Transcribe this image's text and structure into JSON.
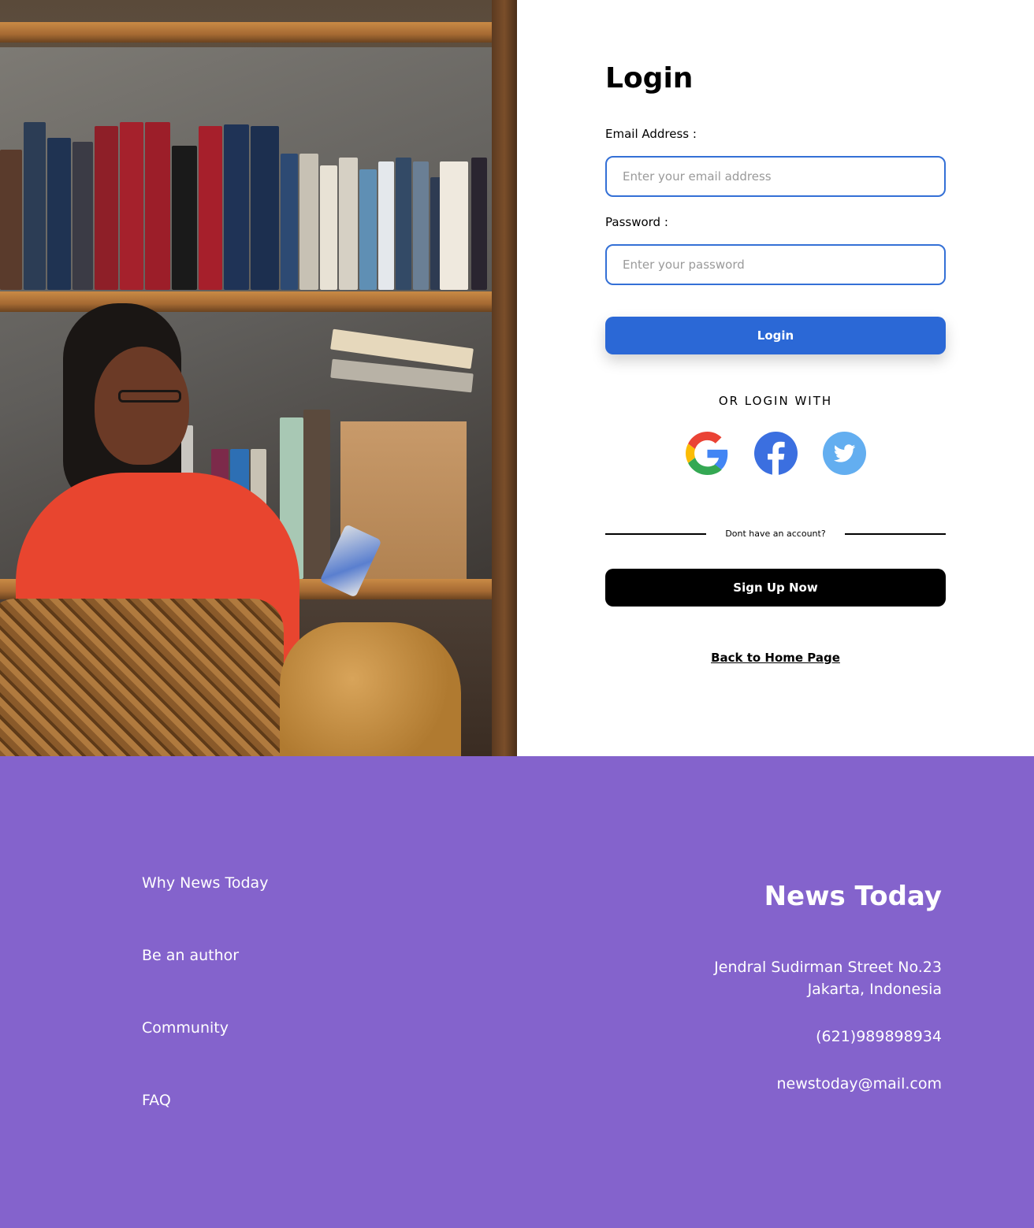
{
  "login": {
    "title": "Login",
    "email_label": "Email Address :",
    "email_placeholder": "Enter your email address",
    "email_value": "",
    "password_label": "Password :",
    "password_placeholder": "Enter your password",
    "password_value": "",
    "login_button": "Login",
    "or_text": "OR LOGIN WITH",
    "social_icons": [
      "google-icon",
      "facebook-icon",
      "twitter-icon"
    ],
    "no_account_text": "Dont have an account?",
    "signup_button": "Sign Up Now",
    "back_link": "Back to Home Page"
  },
  "footer": {
    "links": [
      "Why News Today",
      "Be an author",
      "Community",
      "FAQ"
    ],
    "brand": "News Today",
    "address_line1": "Jendral Sudirman Street No.23",
    "address_line2": "Jakarta, Indonesia",
    "phone": "(621)989898934",
    "email": "newstoday@mail.com"
  },
  "colors": {
    "accent_blue": "#2b68d6",
    "input_border": "#3470d6",
    "footer_bg": "#8463cc",
    "signup_bg": "#000000"
  }
}
